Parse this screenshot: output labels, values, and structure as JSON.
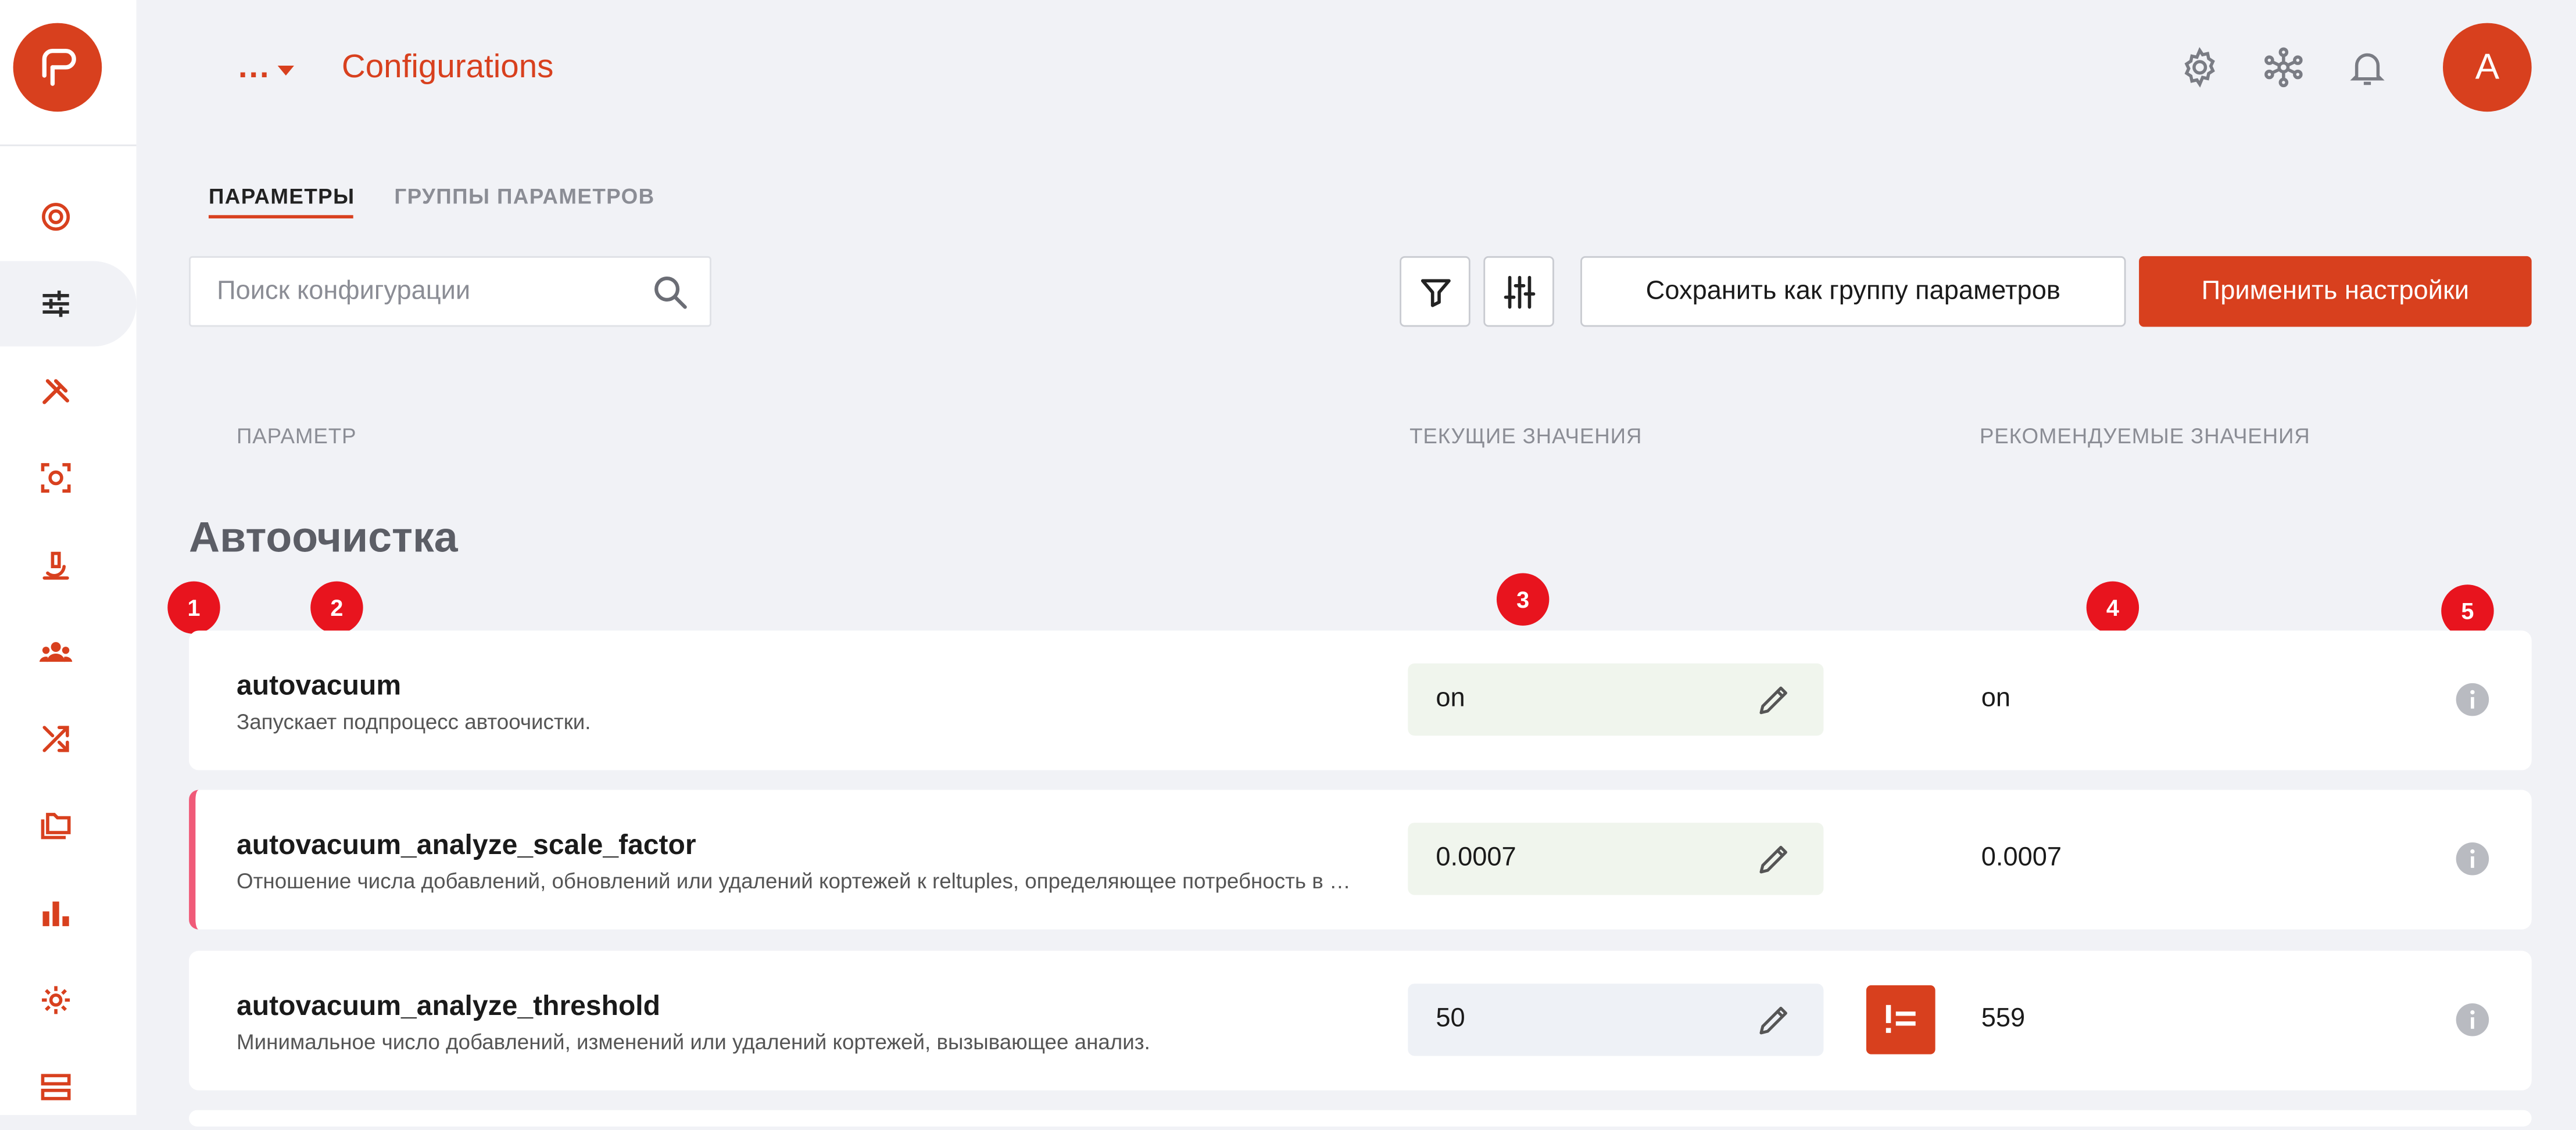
{
  "header": {
    "breadcrumb_dots": "...",
    "title": "Configurations"
  },
  "user": {
    "avatar_letter": "A"
  },
  "tabs": [
    {
      "label": "ПАРАМЕТРЫ",
      "active": true
    },
    {
      "label": "ГРУППЫ ПАРАМЕТРОВ",
      "active": false
    }
  ],
  "toolbar": {
    "search_placeholder": "Поиск конфигурации",
    "save_group_label": "Сохранить как группу параметров",
    "apply_label": "Применить настройки"
  },
  "columns": {
    "param": "ПАРАМЕТР",
    "current": "ТЕКУЩИЕ ЗНАЧЕНИЯ",
    "recommended": "РЕКОМЕНДУЕМЫЕ ЗНАЧЕНИЯ"
  },
  "group": {
    "title": "Автоочистка"
  },
  "markers": [
    "1",
    "2",
    "3",
    "4",
    "5"
  ],
  "rows": [
    {
      "name": "autovacuum",
      "description": "Запускает подпроцесс автоочистки.",
      "current": "on",
      "recommended": "on"
    },
    {
      "name": "autovacuum_analyze_scale_factor",
      "description": "Отношение числа добавлений, обновлений или удалений кортежей к reltuples, определяющее потребность в анализе.",
      "current": "0.0007",
      "recommended": "0.0007"
    },
    {
      "name": "autovacuum_analyze_threshold",
      "description": "Минимальное число добавлений, изменений или удалений кортежей, вызывающее анализ.",
      "current": "50",
      "recommended": "559"
    }
  ],
  "colors": {
    "accent": "#d8401e",
    "marker": "#e8141e",
    "changed_stripe": "#f05a78",
    "current_ok_bg": "#f0f5ed",
    "current_diff_bg": "#eef1f6"
  },
  "icons": {
    "sidebar": [
      "target-icon",
      "sliders-icon",
      "tools-icon",
      "scan-icon",
      "microscope-icon",
      "team-icon",
      "shuffle-icon",
      "folders-icon",
      "bar-chart-icon",
      "gear-icon",
      "server-icon"
    ],
    "header": [
      "settings-icon",
      "network-icon",
      "bell-icon"
    ]
  }
}
